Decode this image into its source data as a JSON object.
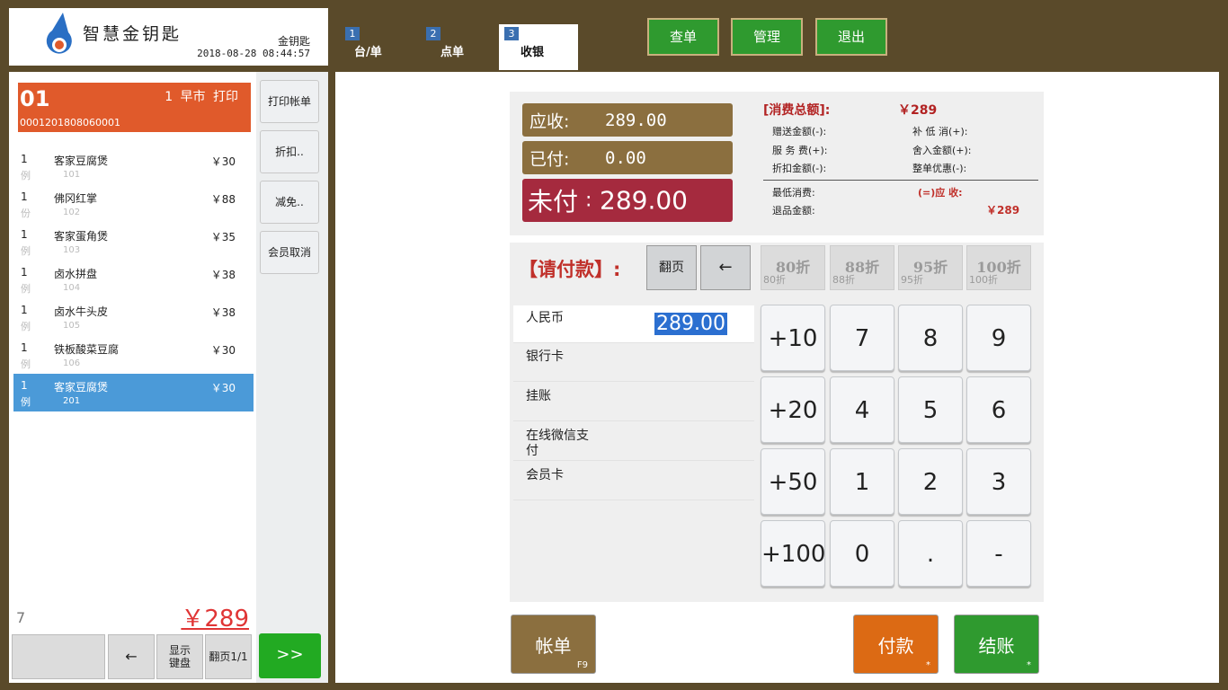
{
  "header": {
    "logo_text": "智慧金钥匙",
    "store_name": "金钥匙",
    "datetime": "2018-08-28 08:44:57",
    "tabs": [
      {
        "num": "1",
        "label": "台/单"
      },
      {
        "num": "2",
        "label": "点单"
      },
      {
        "num": "3",
        "label": "收银"
      }
    ],
    "buttons": {
      "query": "查单",
      "manage": "管理",
      "exit": "退出"
    }
  },
  "order": {
    "table_no": "01",
    "table_info": "1 早市 打印",
    "order_no": "0001201808060001",
    "items": [
      {
        "qty": "1",
        "unit": "例",
        "name": "客家豆腐煲",
        "code": "101",
        "price": "￥30"
      },
      {
        "qty": "1",
        "unit": "份",
        "name": "佛冈红掌",
        "code": "102",
        "price": "￥88"
      },
      {
        "qty": "1",
        "unit": "例",
        "name": "客家蛋角煲",
        "code": "103",
        "price": "￥35"
      },
      {
        "qty": "1",
        "unit": "例",
        "name": "卤水拼盘",
        "code": "104",
        "price": "￥38"
      },
      {
        "qty": "1",
        "unit": "例",
        "name": "卤水牛头皮",
        "code": "105",
        "price": "￥38"
      },
      {
        "qty": "1",
        "unit": "例",
        "name": "铁板酸菜豆腐",
        "code": "106",
        "price": "￥30"
      },
      {
        "qty": "1",
        "unit": "例",
        "name": "客家豆腐煲",
        "code": "201",
        "price": "￥30"
      }
    ],
    "count": "7",
    "total": "￥289",
    "side_buttons": {
      "print_bill": "打印帐单",
      "discount": "折扣..",
      "waive": "减免..",
      "member_cancel": "会员取消"
    },
    "bottom": {
      "back": "←",
      "show_keyboard": "显示键盘",
      "page": "翻页1/1",
      "next": ">>"
    }
  },
  "summary": {
    "receivable_label": "应收:",
    "receivable_value": "289.00",
    "paid_label": "已付:",
    "paid_value": "0.00",
    "unpaid_label": "未付",
    "unpaid_value": "289.00",
    "consume_label": "[消费总额]:",
    "consume_value": "￥289",
    "gift": "赠送金额(-):",
    "supplement": "补 低 消(+):",
    "service": "服 务 费(+):",
    "round_up": "舍入金额(+):",
    "discount": "折扣金额(-):",
    "whole_discount": "整单优惠(-):",
    "min_consume": "最低消费:",
    "should_receive_label": "(=)应 收:",
    "should_receive_value": "￥289",
    "refund": "退品金额:"
  },
  "payment": {
    "title": "【请付款】:",
    "page_btn": "翻页",
    "back_btn": "←",
    "discounts": [
      {
        "big": "80折",
        "small": "80折"
      },
      {
        "big": "88折",
        "small": "88折"
      },
      {
        "big": "95折",
        "small": "95折"
      },
      {
        "big": "100折",
        "small": "100折"
      }
    ],
    "methods": [
      {
        "label": "人民币",
        "value": "289.00"
      },
      {
        "label": "银行卡"
      },
      {
        "label": "挂账"
      },
      {
        "label": "在线微信支付"
      },
      {
        "label": "会员卡"
      }
    ],
    "keypad": [
      [
        "+10",
        "7",
        "8",
        "9"
      ],
      [
        "+20",
        "4",
        "5",
        "6"
      ],
      [
        "+50",
        "1",
        "2",
        "3"
      ],
      [
        "+100",
        "0",
        ".",
        "-"
      ]
    ]
  },
  "actions": {
    "bill": "帐单",
    "bill_key": "F9",
    "pay": "付款",
    "pay_key": "*",
    "checkout": "结账",
    "checkout_key": "*"
  },
  "colors": {
    "unpaid": "#a52a3e",
    "green": "#2f9a2f",
    "orange": "#dc6a14",
    "accent_blue": "#4b9ad8"
  }
}
